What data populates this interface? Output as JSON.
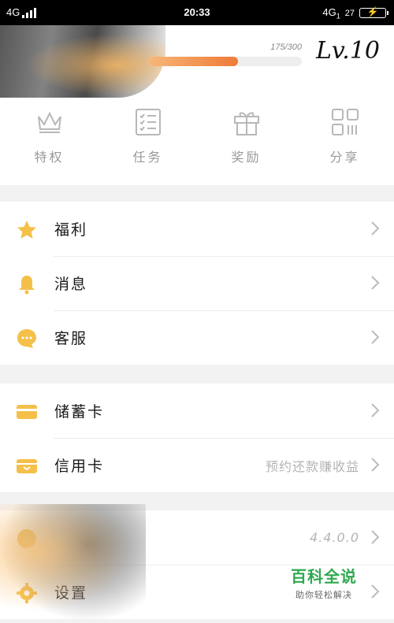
{
  "status_bar": {
    "left_network": "4G",
    "time": "20:33",
    "right_network": "4G",
    "right_sub": "1",
    "battery_level": "27"
  },
  "profile": {
    "progress_text": "175/300",
    "progress_value": 0.583,
    "level": "Lv.10"
  },
  "quick_actions": [
    {
      "label": "特权",
      "icon": "crown-icon"
    },
    {
      "label": "任务",
      "icon": "checklist-icon"
    },
    {
      "label": "奖励",
      "icon": "gift-icon"
    },
    {
      "label": "分享",
      "icon": "qr-grid-icon"
    }
  ],
  "menu_group_1": [
    {
      "label": "福利",
      "icon": "star-icon"
    },
    {
      "label": "消息",
      "icon": "bell-icon"
    },
    {
      "label": "客服",
      "icon": "chat-bubble-icon"
    }
  ],
  "menu_group_2": [
    {
      "label": "储蓄卡",
      "icon": "debit-card-icon",
      "extra": ""
    },
    {
      "label": "信用卡",
      "icon": "credit-card-icon",
      "extra": "预约还款赚收益"
    }
  ],
  "menu_group_3": [
    {
      "label": "",
      "icon": "info-icon",
      "extra": "4.4.0.0"
    },
    {
      "label": "设置",
      "icon": "gear-icon",
      "extra": ""
    }
  ],
  "watermark": {
    "title": "百科全说",
    "subtitle": "助你轻松解决"
  },
  "colors": {
    "accent_orange": "#ef7a38",
    "icon_yellow": "#f5c04a",
    "quick_icon_gray": "#b8b8b8"
  }
}
